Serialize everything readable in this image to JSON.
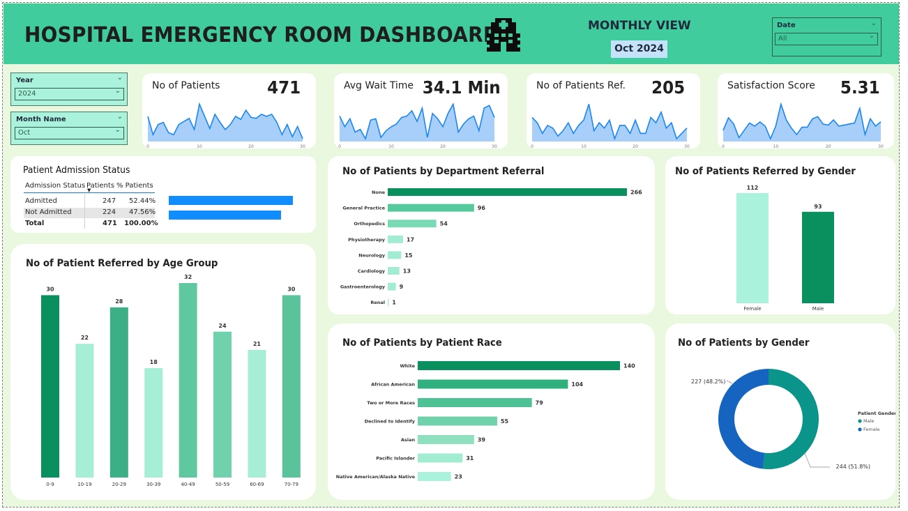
{
  "header": {
    "title": "HOSPITAL EMERGENCY ROOM DASHBOARD",
    "icon": "hospital-icon",
    "monthly_view": "MONTHLY VIEW",
    "month_badge": "Oct 2024",
    "date_slicer": {
      "label": "Date",
      "value": "All"
    }
  },
  "slicers": {
    "year": {
      "label": "Year",
      "value": "2024"
    },
    "month": {
      "label": "Month Name",
      "value": "Oct"
    }
  },
  "kpis": [
    {
      "label": "No of Patients",
      "value": "471",
      "axis": [
        "0",
        "10",
        "20",
        "30"
      ],
      "series": [
        38,
        20,
        30,
        32,
        22,
        20,
        30,
        33,
        36,
        25,
        50,
        38,
        26,
        40,
        32,
        25,
        30,
        38,
        35,
        44,
        37,
        36,
        40,
        38,
        40,
        32,
        20,
        30,
        18,
        28,
        16
      ]
    },
    {
      "label": "Avg Wait Time",
      "value": "34.1 Min",
      "axis": [
        "0",
        "10",
        "20",
        "30"
      ],
      "series": [
        36,
        28,
        34,
        24,
        26,
        19,
        33,
        34,
        20,
        25,
        28,
        30,
        35,
        36,
        40,
        32,
        42,
        20,
        38,
        34,
        28,
        38,
        45,
        24,
        30,
        34,
        36,
        25,
        42,
        44,
        35
      ]
    },
    {
      "label": "No of Patients Ref.",
      "value": "205",
      "axis": [
        "0",
        "10",
        "20",
        "30"
      ],
      "series": [
        18,
        16,
        12,
        15,
        14,
        11,
        13,
        16,
        12,
        15,
        17,
        23,
        13,
        16,
        14,
        17,
        10,
        15,
        15,
        12,
        17,
        12,
        12,
        18,
        16,
        20,
        14,
        16,
        10,
        12,
        14
      ]
    },
    {
      "label": "Satisfaction Score",
      "value": "5.31",
      "axis": [
        "0",
        "10",
        "20",
        "30"
      ],
      "series": [
        5.0,
        6.2,
        5.6,
        4.3,
        5.0,
        5.7,
        5.4,
        5.8,
        5.4,
        4.2,
        5.4,
        7.5,
        6.0,
        5.2,
        4.6,
        5.3,
        5.3,
        6.1,
        6.3,
        5.6,
        5.5,
        6.0,
        5.4,
        5.5,
        5.6,
        5.7,
        7.1,
        4.6,
        6.1,
        5.4,
        5.8
      ]
    }
  ],
  "admission": {
    "title": "Patient Admission Status",
    "headers": [
      "Admission Status",
      "Patients",
      "% Patients"
    ],
    "rows": [
      {
        "status": "Admitted",
        "patients": "247",
        "pct": "52.44%",
        "bar": 0.5244
      },
      {
        "status": "Not Admitted",
        "patients": "224",
        "pct": "47.56%",
        "bar": 0.4756
      }
    ],
    "total": {
      "status": "Total",
      "patients": "471",
      "pct": "100.00%"
    },
    "bar_color": "#118dff"
  },
  "charts": {
    "age_group": {
      "title": "No of Patient Referred by Age Group",
      "chart_data": {
        "type": "bar",
        "categories": [
          "0-9",
          "10-19",
          "20-29",
          "30-39",
          "40-49",
          "50-59",
          "60-69",
          "70-79"
        ],
        "values": [
          30,
          22,
          28,
          18,
          32,
          24,
          21,
          30
        ],
        "colors": [
          "#0a8f5e",
          "#a6efd6",
          "#3daf86",
          "#a6efd6",
          "#60c8a0",
          "#70d1ad",
          "#a6efd6",
          "#5bc39b"
        ]
      }
    },
    "department": {
      "title": "No of Patients by Department Referral",
      "chart_data": {
        "type": "bar",
        "categories": [
          "None",
          "General Practice",
          "Orthopedics",
          "Physiotherapy",
          "Neurology",
          "Cardiology",
          "Gastroenterology",
          "Renal"
        ],
        "values": [
          266,
          96,
          54,
          17,
          15,
          13,
          9,
          1
        ],
        "colors": [
          "#0a8f5e",
          "#56c99d",
          "#79dab4",
          "#a2ecd2",
          "#a2ecd2",
          "#a2ecd2",
          "#a2ecd2",
          "#a2ecd2"
        ]
      }
    },
    "gender_ref": {
      "title": "No of Patients Referred by Gender",
      "chart_data": {
        "type": "bar",
        "categories": [
          "Female",
          "Male"
        ],
        "values": [
          112,
          93
        ],
        "colors": [
          "#abf2dc",
          "#0a8f5e"
        ]
      }
    },
    "race": {
      "title": "No of Patients by Patient Race",
      "chart_data": {
        "type": "bar",
        "categories": [
          "White",
          "African American",
          "Two or More Races",
          "Declined to Identify",
          "Asian",
          "Pacific Islander",
          "Native American/Alaska Native"
        ],
        "values": [
          140,
          104,
          79,
          55,
          39,
          31,
          23
        ],
        "colors": [
          "#0a8f5e",
          "#30b07e",
          "#4fc295",
          "#6fd2ab",
          "#8ee0bf",
          "#a2ecd2",
          "#abf2dc"
        ]
      }
    },
    "gender_donut": {
      "title": "No of Patients by Gender",
      "legend_title": "Patient Gender",
      "chart_data": {
        "type": "pie",
        "categories": [
          "Male",
          "Female"
        ],
        "values": [
          244,
          227
        ],
        "labels": [
          "244 (51.8%)",
          "227 (48.2%)"
        ],
        "colors": [
          "#0a948a",
          "#1565c0"
        ]
      }
    }
  }
}
